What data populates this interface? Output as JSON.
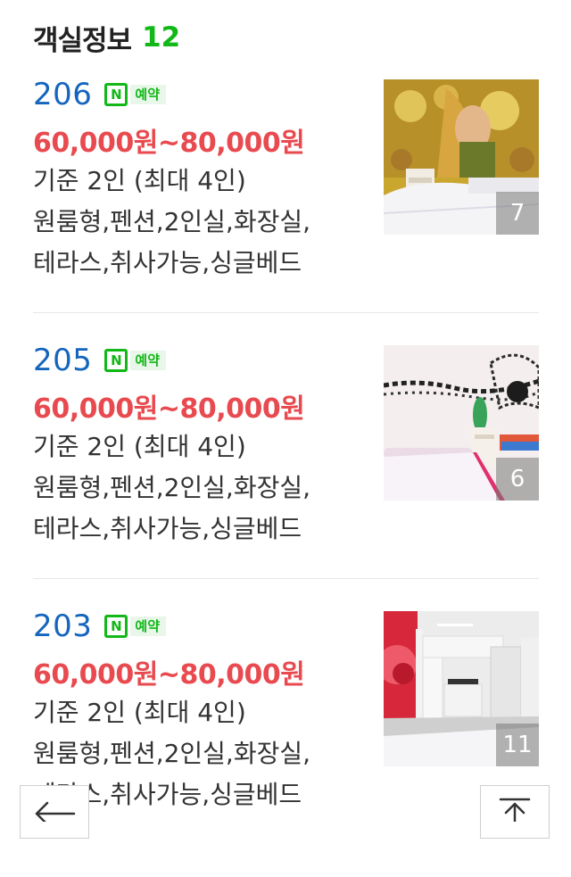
{
  "header": {
    "title": "객실정보",
    "count": "12"
  },
  "rooms": [
    {
      "number": "206",
      "badge_icon": "N",
      "badge_text": "예약",
      "price": "60,000원~80,000원",
      "capacity": "기준 2인 (최대 4인)",
      "features_line1": "원룸형,펜션,2인실,화장실,",
      "features_line2": "테라스,취사가능,싱글베드",
      "photo_count": "7"
    },
    {
      "number": "205",
      "badge_icon": "N",
      "badge_text": "예약",
      "price": "60,000원~80,000원",
      "capacity": "기준 2인 (최대 4인)",
      "features_line1": "원룸형,펜션,2인실,화장실,",
      "features_line2": "테라스,취사가능,싱글베드",
      "photo_count": "6"
    },
    {
      "number": "203",
      "badge_icon": "N",
      "badge_text": "예약",
      "price": "60,000원~80,000원",
      "capacity": "기준 2인 (최대 4인)",
      "features_line1": "원룸형,펜션,2인실,화장실,",
      "features_line2": "테라스,취사가능,싱글베드",
      "photo_count": "11"
    }
  ],
  "controls": {
    "back_icon": "arrow-left-icon",
    "top_icon": "scroll-to-top-icon"
  },
  "colors": {
    "room_number": "#1465bd",
    "price": "#e84a4f",
    "naver_green": "#12b817"
  }
}
